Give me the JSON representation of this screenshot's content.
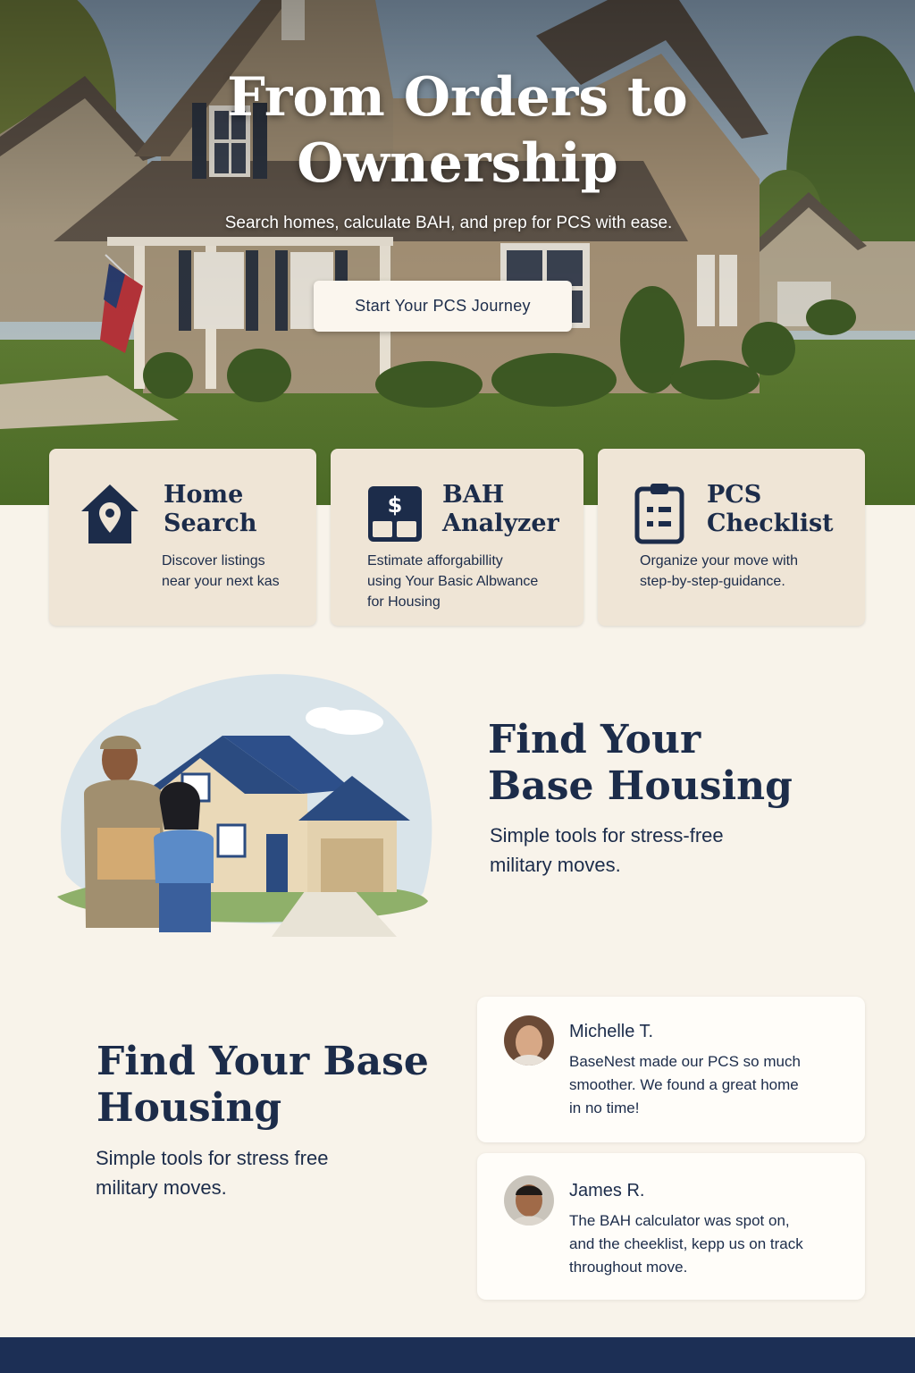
{
  "hero": {
    "title_line1": "From Orders to",
    "title_line2": "Ownership",
    "subtitle": "Search homes, calculate BAH, and prep for PCS with ease.",
    "cta_label": "Start Your PCS Journey"
  },
  "features": [
    {
      "icon": "house-pin-icon",
      "title_line1": "Home",
      "title_line2": "Search",
      "desc_line1": "Discover listings",
      "desc_line2": "near your next kas",
      "desc_line3": ""
    },
    {
      "icon": "calculator-dollar-icon",
      "title_line1": "BAH",
      "title_line2": "Analyzer",
      "desc_line1": "Estimate afforgabillity",
      "desc_line2": "using Your Basic Albwance",
      "desc_line3": "for Housing"
    },
    {
      "icon": "clipboard-checklist-icon",
      "title_line1": "PCS",
      "title_line2": "Checklist",
      "desc_line1": "Organize your move with",
      "desc_line2": "step-by-step-guidance.",
      "desc_line3": ""
    }
  ],
  "section_find": {
    "title_line1": "Find Your",
    "title_line2": "Base Housing",
    "subtitle_line1": "Simple tools for stress-free",
    "subtitle_line2": "military moves."
  },
  "section_find_2": {
    "title_line1": "Find Your Base",
    "title_line2": "Housing",
    "subtitle_line1": "Simple tools for stress free",
    "subtitle_line2": "military moves."
  },
  "testimonials": [
    {
      "name": "Michelle T.",
      "quote_line1": "BaseNest made our PCS so much",
      "quote_line2": "smoother. We found a great home",
      "quote_line3": "in no time!"
    },
    {
      "name": "James R.",
      "quote_line1": "The BAH calculator was spot on,",
      "quote_line2": "and the cheeklist, kepp us on track",
      "quote_line3": "throughout move."
    }
  ],
  "colors": {
    "navy": "#1c2c4a",
    "card_bg": "#efe5d6",
    "page_bg": "#f8f3ea",
    "footer": "#1c2f55"
  }
}
